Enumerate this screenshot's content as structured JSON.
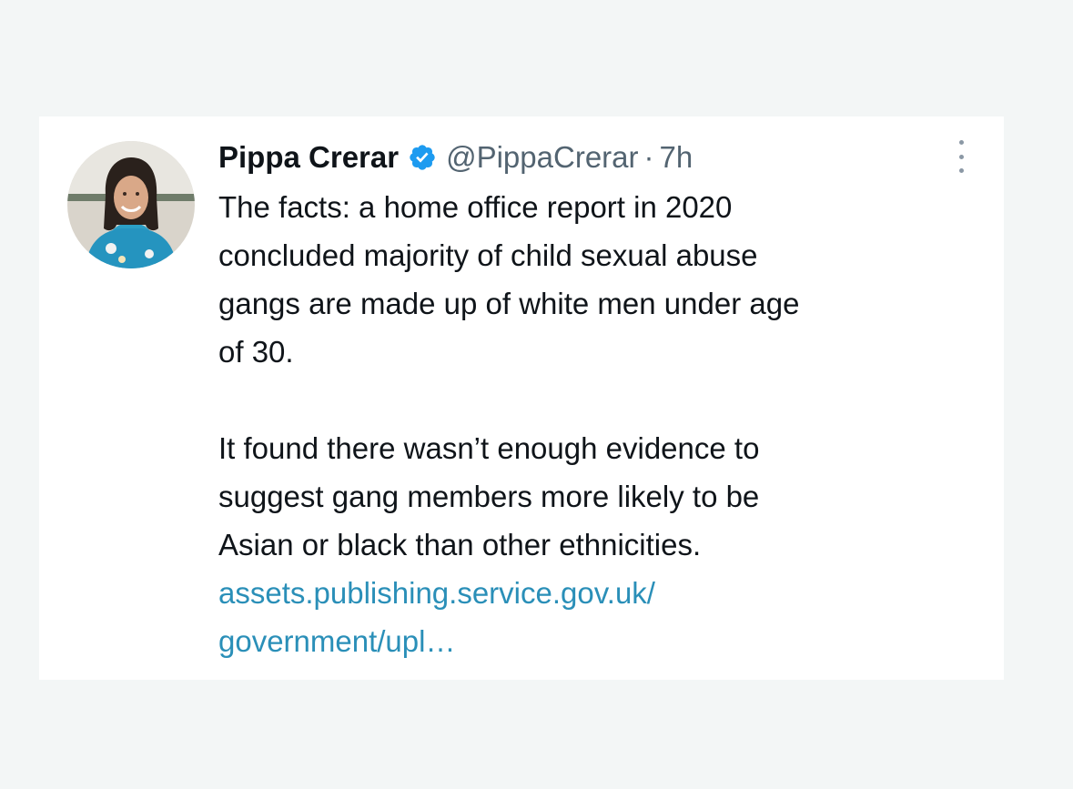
{
  "tweet": {
    "author": {
      "name": "Pippa Crerar",
      "handle": "@PippaCrerar",
      "verified": true
    },
    "separator": "·",
    "timestamp": "7h",
    "paragraph1": [
      "The facts: a home office report in 2020",
      "concluded majority of child sexual abuse",
      "gangs are made up of white men under age",
      "of 30."
    ],
    "paragraph2": [
      "It found there wasn’t enough evidence to",
      "suggest gang members more likely to be",
      "Asian or black than other ethnicities."
    ],
    "link": {
      "line1": "assets.publishing.service.gov.uk/",
      "line2": "government/upl…"
    }
  },
  "icons": {
    "verified": "verified-badge-icon",
    "more": "more-options-icon"
  },
  "colors": {
    "background": "#f3f6f6",
    "card": "#ffffff",
    "text": "#0f1419",
    "muted": "#536471",
    "link": "#2a8fb8",
    "verified": "#1d9bf0"
  }
}
